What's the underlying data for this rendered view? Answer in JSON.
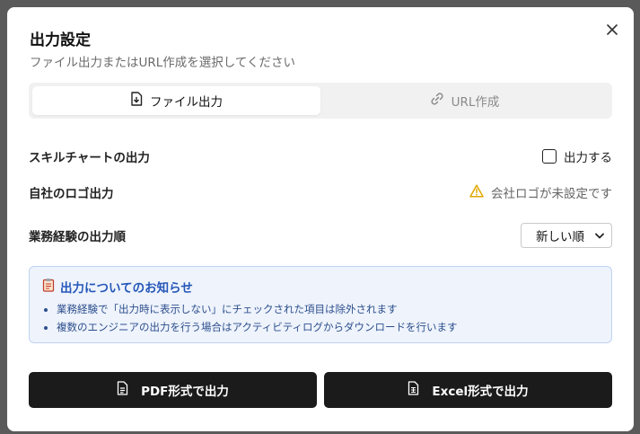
{
  "dialog": {
    "title": "出力設定",
    "subtitle": "ファイル出力またはURL作成を選択してください"
  },
  "tabs": [
    {
      "label": "ファイル出力",
      "icon": "file-download-icon",
      "active": true
    },
    {
      "label": "URL作成",
      "icon": "link-icon",
      "active": false
    }
  ],
  "options": {
    "skill_chart": {
      "label": "スキルチャートの出力",
      "checkbox_label": "出力する",
      "checked": false
    },
    "logo": {
      "label": "自社のロゴ出力",
      "warning": "会社ロゴが未設定です"
    },
    "order": {
      "label": "業務経験の出力順",
      "selected": "新しい順"
    }
  },
  "notice": {
    "icon": "clipboard-icon",
    "title": "出力についてのお知らせ",
    "items": [
      "業務経験で「出力時に表示しない」にチェックされた項目は除外されます",
      "複数のエンジニアの出力を行う場合はアクティビティログからダウンロードを行います"
    ]
  },
  "buttons": {
    "pdf": "PDF形式で出力",
    "excel": "Excel形式で出力"
  },
  "colors": {
    "accent_blue": "#2557b8",
    "warning": "#e0a800",
    "button_bg": "#1b1b1b"
  }
}
